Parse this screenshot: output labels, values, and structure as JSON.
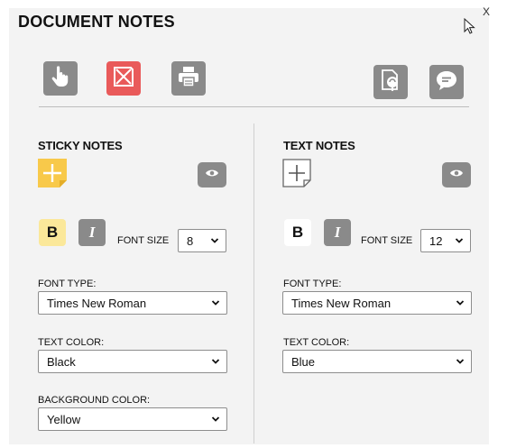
{
  "window": {
    "title": "DOCUMENT NOTES",
    "close_label": "X"
  },
  "toolbar": {
    "buttons": [
      {
        "name": "select-tool",
        "icon": "hand-pointer-icon"
      },
      {
        "name": "delete-tool",
        "icon": "delete-note-icon"
      },
      {
        "name": "print-tool",
        "icon": "printer-icon"
      },
      {
        "name": "note-search-tool",
        "icon": "document-search-icon"
      },
      {
        "name": "comment-tool",
        "icon": "speech-bubble-icon"
      }
    ]
  },
  "sticky": {
    "title": "STICKY NOTES",
    "font_size_label": "FONT SIZE",
    "font_size": "8",
    "bold_label": "B",
    "italic_label": "I",
    "font_type_label": "FONT TYPE:",
    "font_type": "Times New Roman",
    "text_color_label": "TEXT COLOR:",
    "text_color": "Black",
    "bg_color_label": "BACKGROUND COLOR:",
    "bg_color": "Yellow"
  },
  "text_notes": {
    "title": "TEXT NOTES",
    "font_size_label": "FONT SIZE",
    "font_size": "12",
    "bold_label": "B",
    "italic_label": "I",
    "font_type_label": "FONT TYPE:",
    "font_type": "Times New Roman",
    "text_color_label": "TEXT COLOR:",
    "text_color": "Blue"
  },
  "colors": {
    "accent_yellow": "#f8c94a",
    "button_gray": "#8a8a8a",
    "delete_red": "#e95a5a"
  }
}
